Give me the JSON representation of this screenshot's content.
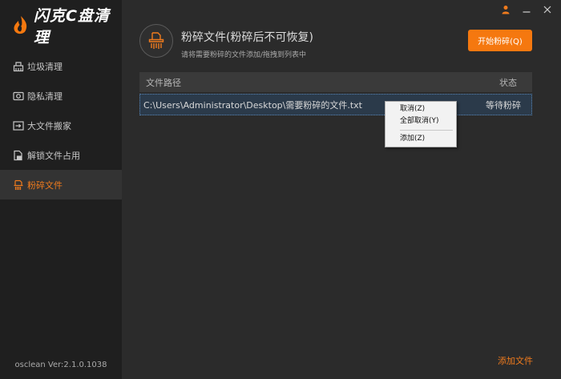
{
  "app": {
    "logo_text": "闪克C盘清理",
    "version": "osclean Ver:2.1.0.1038"
  },
  "sidebar": {
    "items": [
      {
        "label": "垃圾清理",
        "icon": "broom-icon"
      },
      {
        "label": "隐私清理",
        "icon": "privacy-icon"
      },
      {
        "label": "大文件搬家",
        "icon": "move-file-icon"
      },
      {
        "label": "解锁文件占用",
        "icon": "unlock-file-icon"
      },
      {
        "label": "粉碎文件",
        "icon": "shred-file-icon"
      }
    ],
    "active_index": 4
  },
  "header": {
    "title": "粉碎文件(粉碎后不可恢复)",
    "subtitle": "请将需要粉碎的文件添加/拖拽到列表中",
    "start_label": "开始粉碎(Q)"
  },
  "table": {
    "columns": [
      "文件路径",
      "状态"
    ],
    "rows": [
      {
        "path": "C:\\Users\\Administrator\\Desktop\\需要粉碎的文件.txt",
        "status": "等待粉碎"
      }
    ]
  },
  "context_menu": {
    "items": [
      "取消(Z)",
      "全部取消(Y)",
      "添加(Z)"
    ]
  },
  "footer": {
    "add_file_label": "添加文件"
  },
  "colors": {
    "accent": "#f5780f",
    "sidebar_bg": "#1f1f1f",
    "main_bg": "#2b2b2b"
  }
}
